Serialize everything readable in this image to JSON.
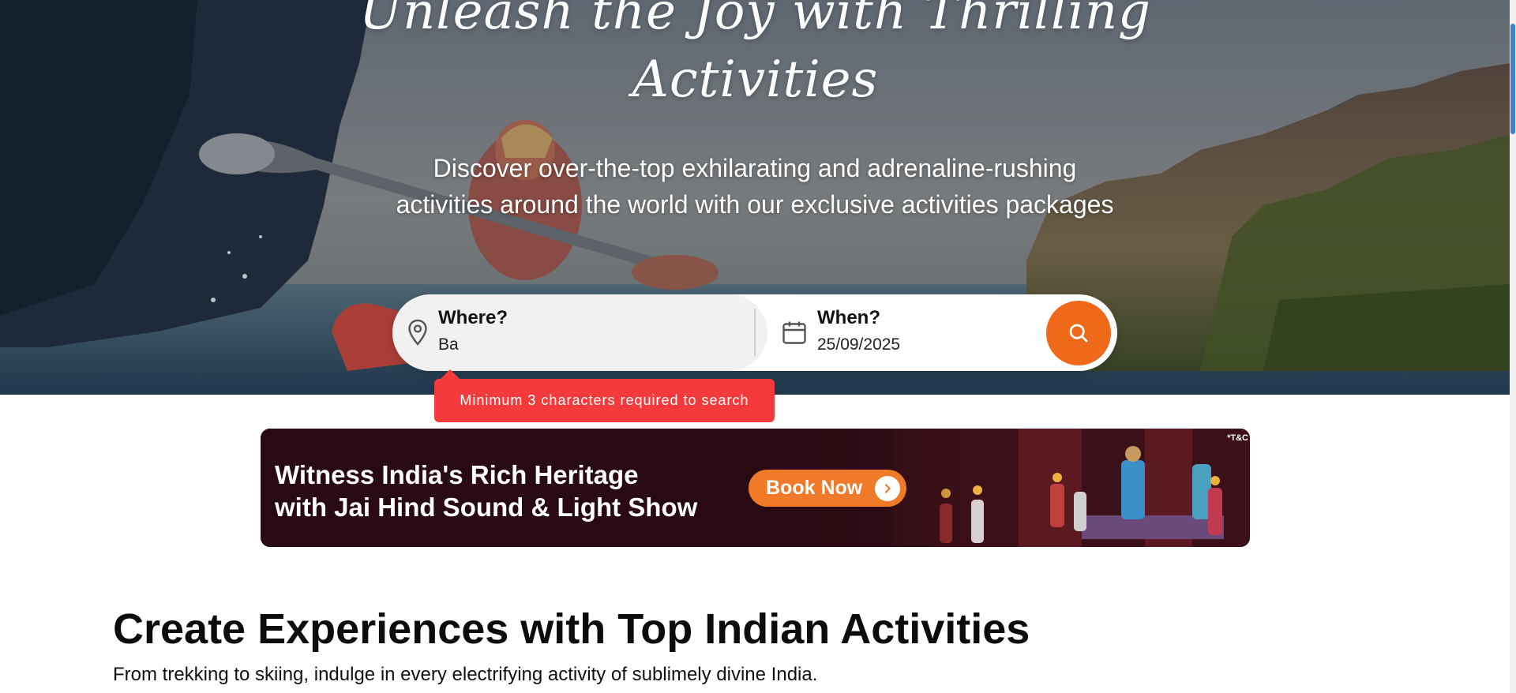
{
  "hero": {
    "title_line1": "Unleash the Joy with Thrilling",
    "title_line2": "Activities",
    "description": "Discover over-the-top exhilarating and adrenaline-rushing activities around the world with our exclusive activities packages"
  },
  "search": {
    "where_label": "Where?",
    "where_value": "Ba",
    "when_label": "When?",
    "when_value": "25/09/2025",
    "error_message": "Minimum 3 characters required to search",
    "accent_color": "#ee6a1a",
    "error_color": "#f43a3a",
    "icons": {
      "where": "location-pin-icon",
      "when": "calendar-icon",
      "search": "search-icon"
    }
  },
  "banner": {
    "headline_line1": "Witness India's Rich Heritage",
    "headline_line2": "with Jai Hind Sound & Light Show",
    "button_label": "Book Now",
    "terms_note": "*T&C",
    "button_color": "#f07a28",
    "background_color": "#2a0a12"
  },
  "section": {
    "title": "Create Experiences with Top Indian Activities",
    "subtitle": "From trekking to skiing, indulge in every electrifying activity of sublimely divine India."
  }
}
